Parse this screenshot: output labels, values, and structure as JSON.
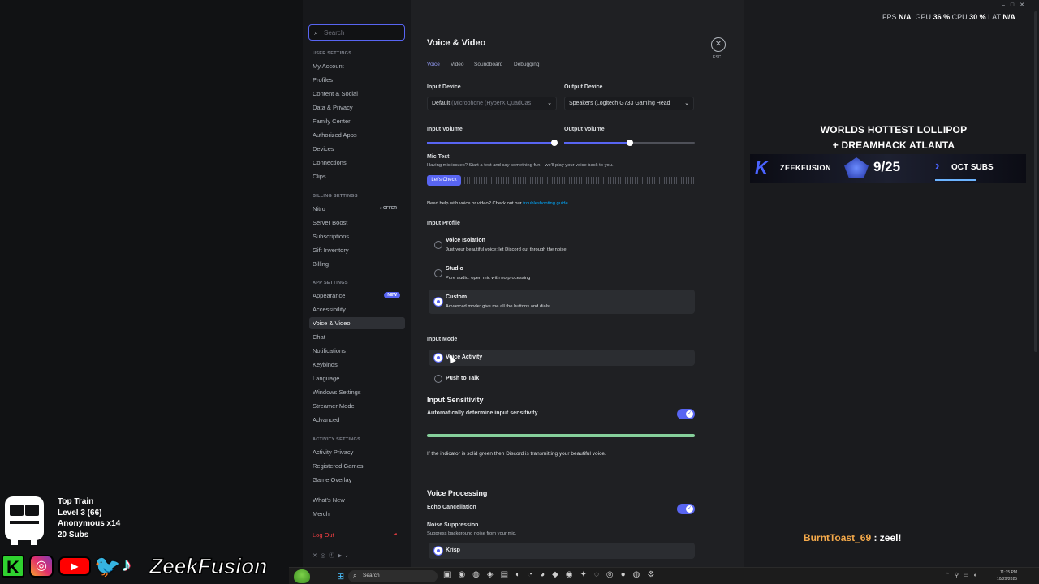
{
  "hud": {
    "fps_label": "FPS",
    "fps": "N/A",
    "gpu_label": "GPU",
    "gpu": "36 %",
    "cpu_label": "CPU",
    "cpu": "30 %",
    "lat_label": "LAT",
    "lat": "N/A"
  },
  "sidebar": {
    "search_placeholder": "Search",
    "sections": [
      {
        "title": "USER SETTINGS",
        "items": [
          {
            "label": "My Account"
          },
          {
            "label": "Profiles"
          },
          {
            "label": "Content & Social"
          },
          {
            "label": "Data & Privacy"
          },
          {
            "label": "Family Center"
          },
          {
            "label": "Authorized Apps"
          },
          {
            "label": "Devices"
          },
          {
            "label": "Connections"
          },
          {
            "label": "Clips"
          }
        ]
      },
      {
        "title": "BILLING SETTINGS",
        "items": [
          {
            "label": "Nitro",
            "badge": "OFFER"
          },
          {
            "label": "Server Boost"
          },
          {
            "label": "Subscriptions"
          },
          {
            "label": "Gift Inventory"
          },
          {
            "label": "Billing"
          }
        ]
      },
      {
        "title": "APP SETTINGS",
        "items": [
          {
            "label": "Appearance",
            "badge": "NEW"
          },
          {
            "label": "Accessibility"
          },
          {
            "label": "Voice & Video",
            "active": true
          },
          {
            "label": "Chat"
          },
          {
            "label": "Notifications"
          },
          {
            "label": "Keybinds"
          },
          {
            "label": "Language"
          },
          {
            "label": "Windows Settings"
          },
          {
            "label": "Streamer Mode"
          },
          {
            "label": "Advanced"
          }
        ]
      },
      {
        "title": "ACTIVITY SETTINGS",
        "items": [
          {
            "label": "Activity Privacy"
          },
          {
            "label": "Registered Games"
          },
          {
            "label": "Game Overlay"
          }
        ]
      }
    ],
    "whats_new": "What's New",
    "merch": "Merch",
    "logout": "Log Out"
  },
  "main": {
    "title": "Voice & Video",
    "tabs": [
      "Voice",
      "Video",
      "Soundboard",
      "Debugging"
    ],
    "esc": "ESC",
    "input_device_label": "Input Device",
    "input_device_value": "Default",
    "input_device_detail": "(Microphone (HyperX QuadCas",
    "output_device_label": "Output Device",
    "output_device_value": "Speakers (Logitech G733 Gaming Head",
    "input_volume_label": "Input Volume",
    "input_volume": 0.98,
    "output_volume_label": "Output Volume",
    "output_volume": 0.5,
    "mic_test_label": "Mic Test",
    "mic_test_desc": "Having mic issues? Start a test and say something fun—we'll play your voice back to you.",
    "lets_check": "Let's Check",
    "help_text": "Need help with voice or video? Check out our",
    "help_link": "troubleshooting guide.",
    "input_profile_label": "Input Profile",
    "profiles": [
      {
        "title": "Voice Isolation",
        "desc": "Just your beautiful voice: let Discord cut through the noise",
        "selected": false
      },
      {
        "title": "Studio",
        "desc": "Pure audio: open mic with no processing",
        "selected": false
      },
      {
        "title": "Custom",
        "desc": "Advanced mode: give me all the buttons and dials!",
        "selected": true
      }
    ],
    "input_mode_label": "Input Mode",
    "modes": [
      {
        "title": "Voice Activity",
        "selected": true
      },
      {
        "title": "Push to Talk",
        "selected": false
      }
    ],
    "input_sensitivity_title": "Input Sensitivity",
    "auto_sensitivity": "Automatically determine input sensitivity",
    "sensitivity_note": "If the indicator is solid green then Discord is transmitting your beautiful voice.",
    "voice_processing_title": "Voice Processing",
    "echo_cancellation": "Echo Cancellation",
    "noise_suppression": "Noise Suppression",
    "noise_suppression_desc": "Suppress background noise from your mic.",
    "krisp": "Krisp"
  },
  "overlay": {
    "promo_line1": "WORLDS HOTTEST LOLLIPOP",
    "promo_line2": "+ DREAMHACK ATLANTA",
    "banner_brand": "ZEEKFUSION",
    "banner_date": "9/25",
    "banner_subs": "OCT SUBS",
    "chat_user": "BurntToast_69",
    "chat_msg": " : zeel!",
    "train_title": "Top Train",
    "train_level": "Level 3  (66)",
    "train_anon": "Anonymous x14",
    "train_subs": "20 Subs",
    "social_name": "ZeekFusion"
  },
  "taskbar": {
    "search": "Search",
    "time": "11:15 PM",
    "date": "10/29/2025"
  },
  "colors": {
    "accent": "#5865f2",
    "danger": "#f23f43",
    "green": "#86d09b"
  }
}
